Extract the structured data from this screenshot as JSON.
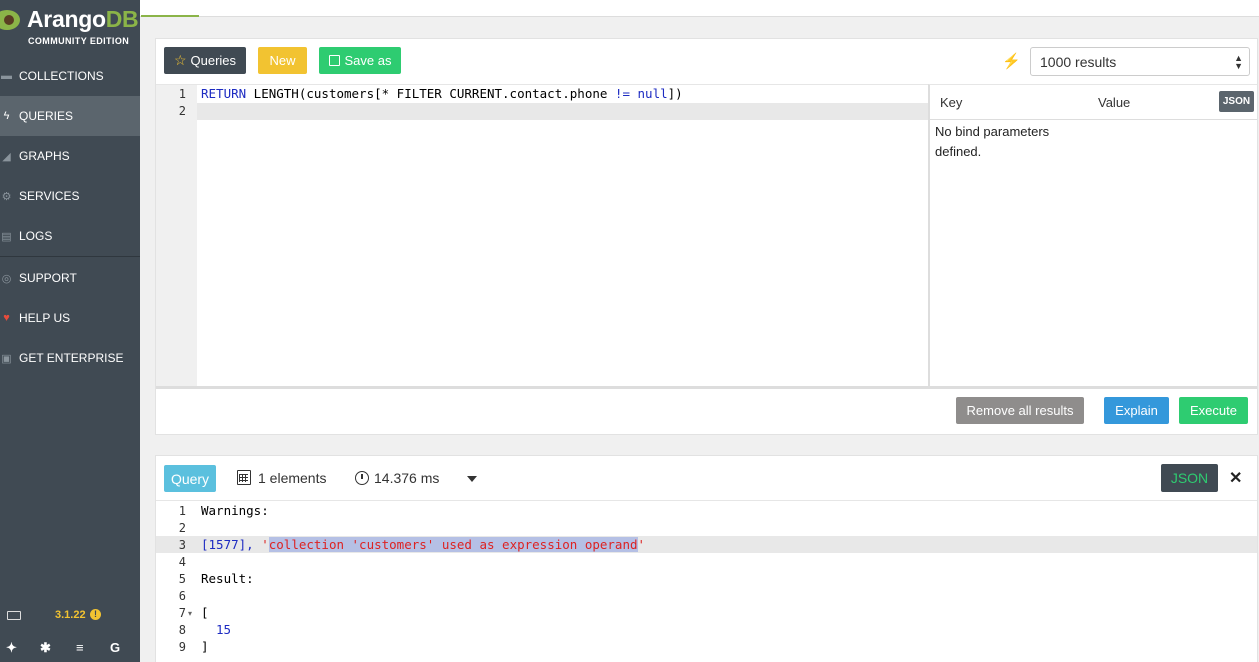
{
  "sidebar": {
    "logo": {
      "brand_main": "Arango",
      "brand_db": "DB",
      "edition": "COMMUNITY EDITION"
    },
    "items": [
      {
        "label": "COLLECTIONS",
        "icon": "folder-icon"
      },
      {
        "label": "QUERIES",
        "icon": "bolt-icon",
        "active": true
      },
      {
        "label": "GRAPHS",
        "icon": "area-chart-icon"
      },
      {
        "label": "SERVICES",
        "icon": "cogs-icon"
      },
      {
        "label": "LOGS",
        "icon": "file-icon"
      },
      {
        "label": "SUPPORT",
        "icon": "lifebuoy-icon"
      },
      {
        "label": "HELP US",
        "icon": "heart-icon"
      },
      {
        "label": "GET ENTERPRISE",
        "icon": "image-icon"
      }
    ],
    "version": "3.1.22",
    "footer_icons": [
      "twitter-icon",
      "slack-icon",
      "stackoverflow-icon",
      "google-icon"
    ]
  },
  "toolbar": {
    "queries_label": "Queries",
    "new_label": "New",
    "save_label": "Save as",
    "results_select": "1000 results"
  },
  "editor": {
    "line_numbers": [
      "1",
      "2"
    ],
    "line1": {
      "kw_return": "RETURN",
      "part1": " LENGTH(customers[* ",
      "kw_filter": "FILTER",
      "part2": " CURRENT.contact.phone ",
      "op": "!=",
      "space": " ",
      "null": "null",
      "part3": "])"
    }
  },
  "bind_params": {
    "key_header": "Key",
    "value_header": "Value",
    "json_label": "JSON",
    "empty_text": "No bind parameters defined."
  },
  "actions": {
    "remove_label": "Remove all results",
    "explain_label": "Explain",
    "execute_label": "Execute"
  },
  "result": {
    "tab_label": "Query",
    "count_text": "1 elements",
    "time_text": "14.376 ms",
    "json_label": "JSON",
    "line_numbers": [
      "1",
      "2",
      "3",
      "4",
      "5",
      "6",
      "7",
      "8",
      "9"
    ],
    "lines": {
      "l1": "Warnings:",
      "l3_code": "[1577], ",
      "l3_q1": "'",
      "l3_sel": "collection 'customers' used as expression operand",
      "l3_q2": "'",
      "l5": "Result:",
      "l7": "[",
      "l8": "15",
      "l9": "]"
    }
  },
  "colors": {
    "sidebar_bg": "#404a53",
    "accent_green": "#8bb448",
    "warning_yellow": "#f2c331",
    "success": "#2ecc71",
    "info": "#3498db"
  }
}
